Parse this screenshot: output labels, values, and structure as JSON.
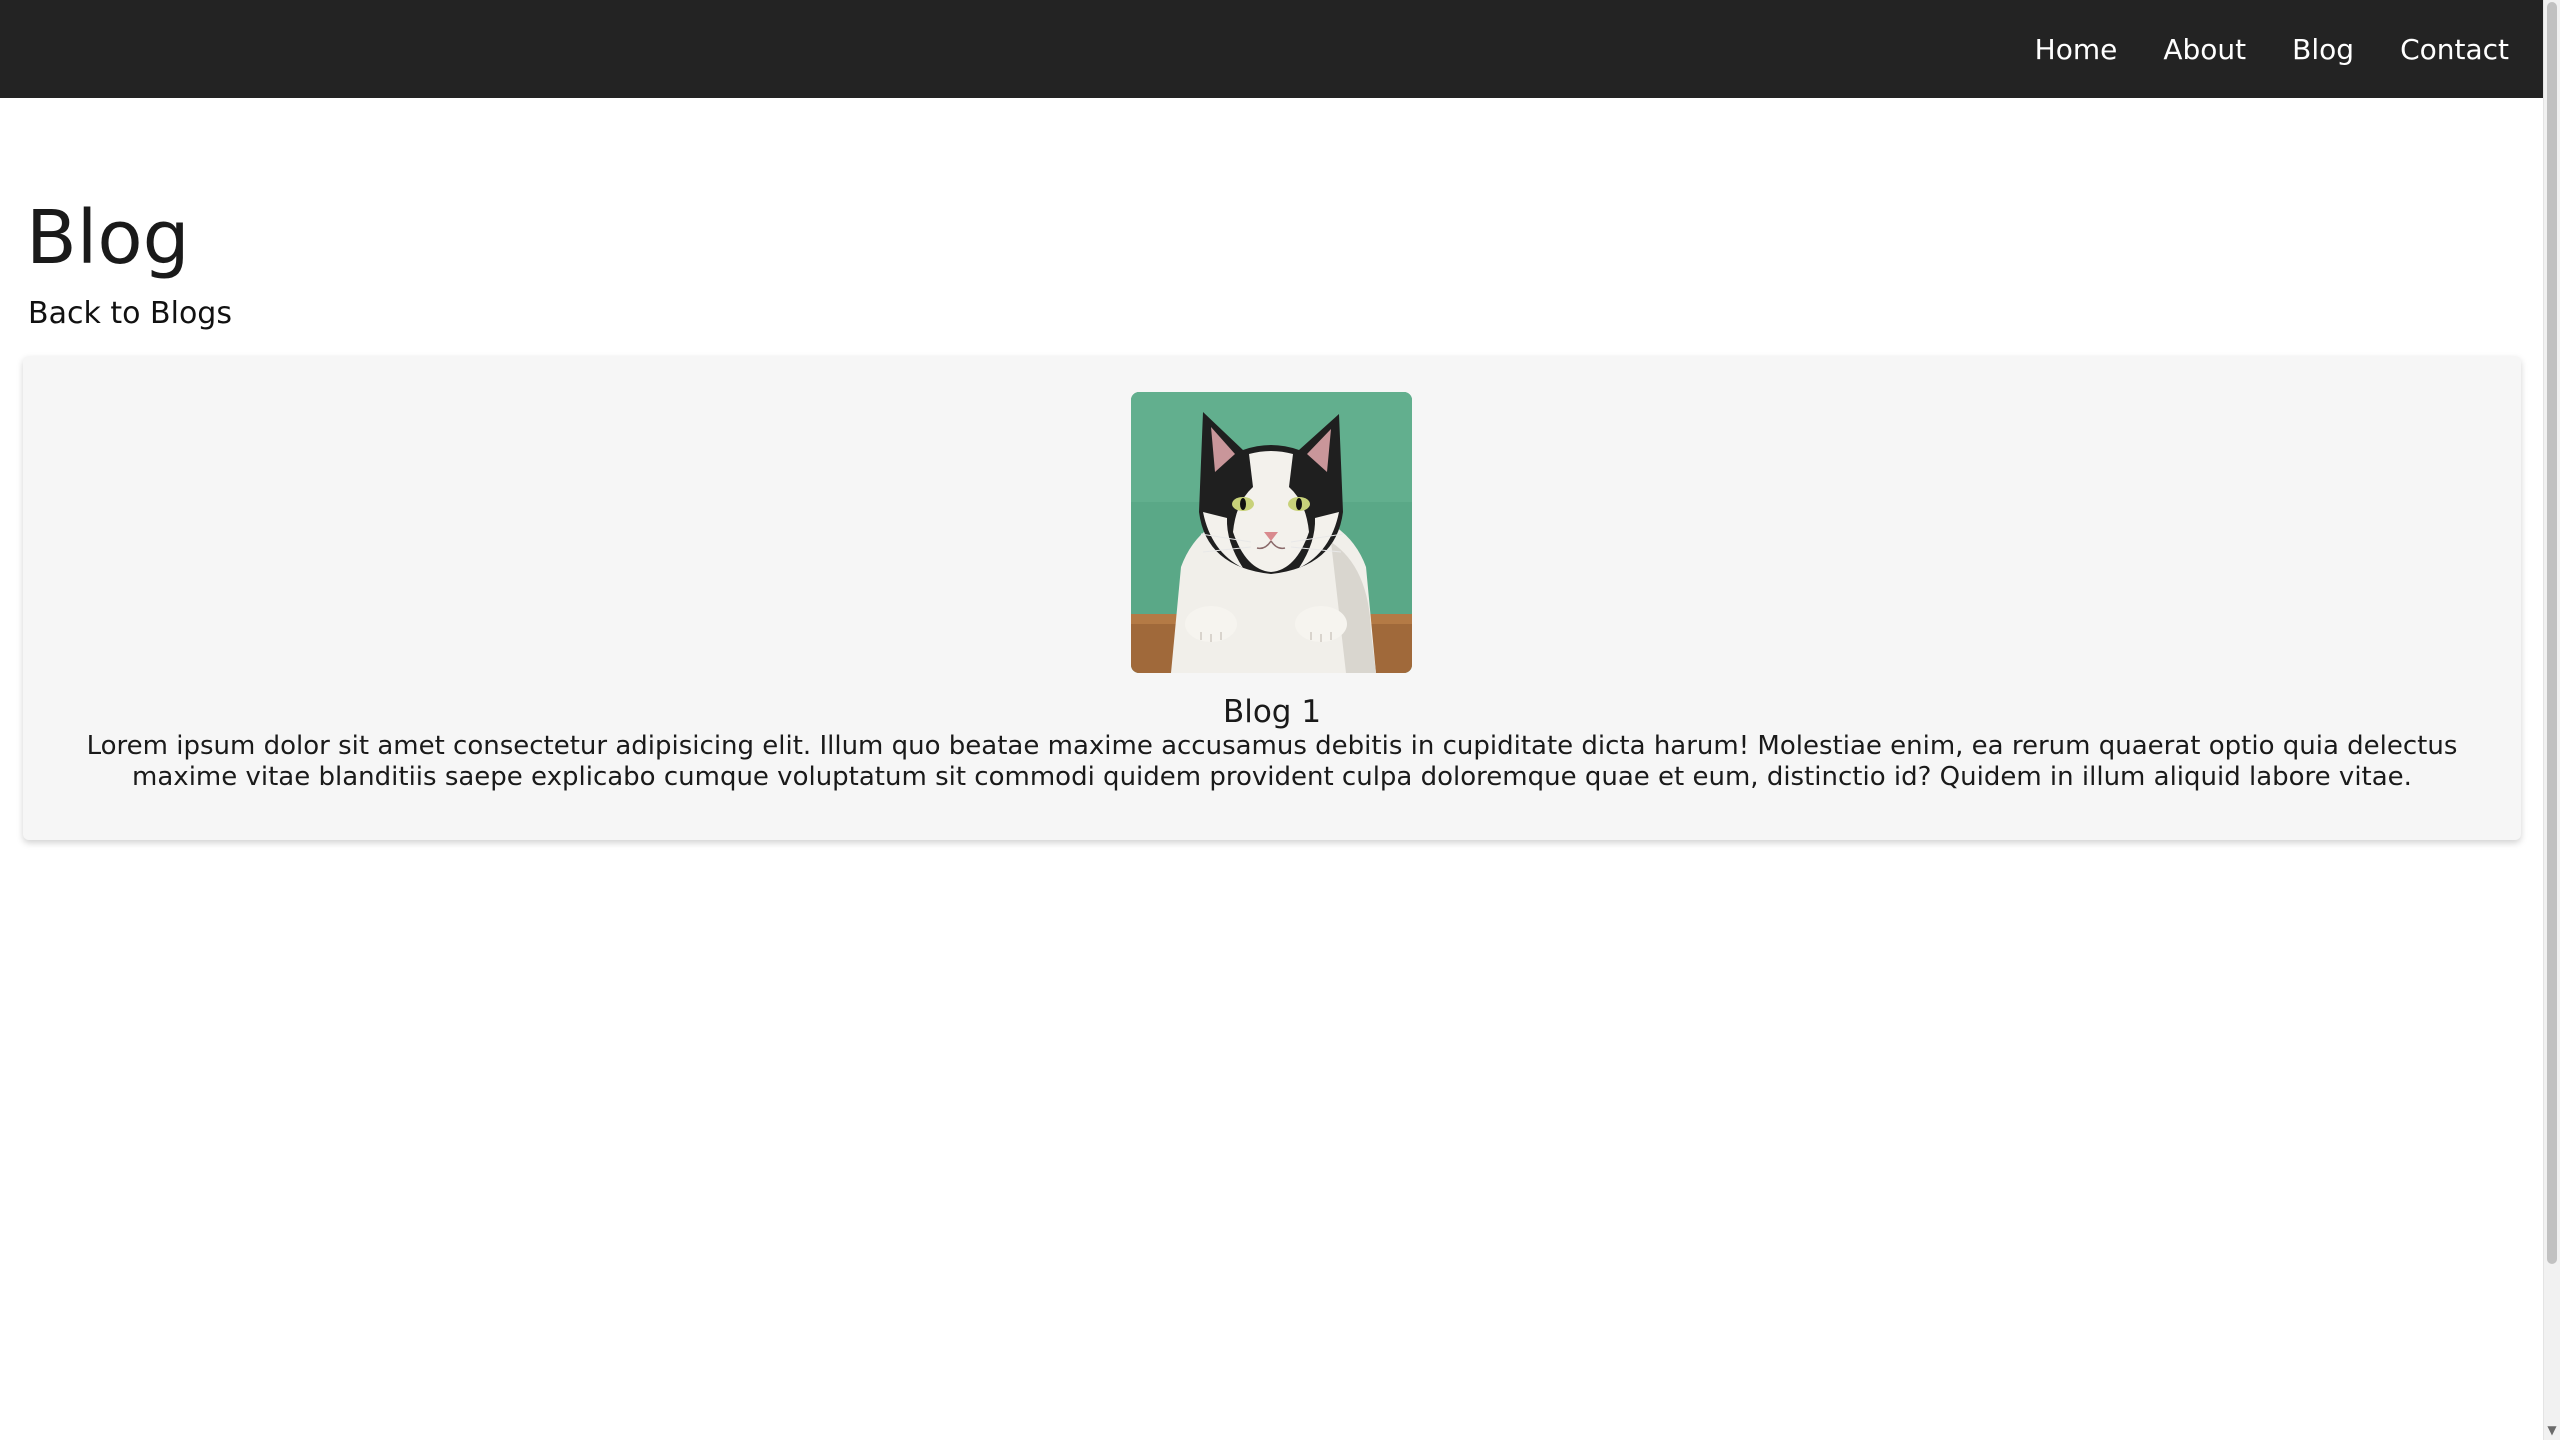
{
  "nav": {
    "links": [
      {
        "label": "Home"
      },
      {
        "label": "About"
      },
      {
        "label": "Blog"
      },
      {
        "label": "Contact"
      }
    ]
  },
  "page": {
    "title": "Blog",
    "back_link": "Back to Blogs"
  },
  "post": {
    "title": "Blog 1",
    "body": "Lorem ipsum dolor sit amet consectetur adipisicing elit. Illum quo beatae maxime accusamus debitis in cupiditate dicta harum! Molestiae enim, ea rerum quaerat optio quia delectus maxime vitae blanditiis saepe explicabo cumque voluptatum sit commodi quidem provident culpa doloremque quae et eum, distinctio id? Quidem in illum aliquid labore vitae.",
    "image_subject": "cat-photo"
  },
  "colors": {
    "navbar": "#232323",
    "card": "#f6f6f6",
    "image_background": "#5aa887"
  }
}
